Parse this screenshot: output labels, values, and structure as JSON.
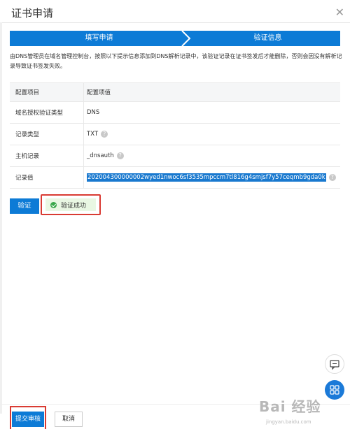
{
  "dialog": {
    "title": "证书申请",
    "close_icon": "close-icon"
  },
  "steps": [
    {
      "label": "填写申请"
    },
    {
      "label": "验证信息"
    }
  ],
  "description": "由DNS管理员在域名管理控制台，按照以下提示信息添加到DNS解析记录中，该验证记录在证书签发后才能删除，否则会因没有解析记录导致证书签发失败。",
  "table": {
    "header": {
      "col1": "配置项目",
      "col2": "配置项值"
    },
    "rows": [
      {
        "label": "域名授权验证类型",
        "value": "DNS",
        "help": false
      },
      {
        "label": "记录类型",
        "value": "TXT",
        "help": true
      },
      {
        "label": "主机记录",
        "value": "_dnsauth",
        "help": true
      },
      {
        "label": "记录值",
        "value": "202004300000002wyed1nwoc6sf3535mpccm7tl816g4smjsf7y57ceqmb9gda0k",
        "help": true,
        "selected": true
      }
    ]
  },
  "verify_button": "验证",
  "verify_status": "验证成功",
  "footer": {
    "submit": "提交审核",
    "cancel": "取消"
  },
  "watermark": {
    "main": "Bai 经验",
    "sub": "jingyan.baidu.com"
  },
  "colors": {
    "primary": "#0d7bd6",
    "success": "#3aa84b",
    "highlight_border": "#d93b33"
  }
}
